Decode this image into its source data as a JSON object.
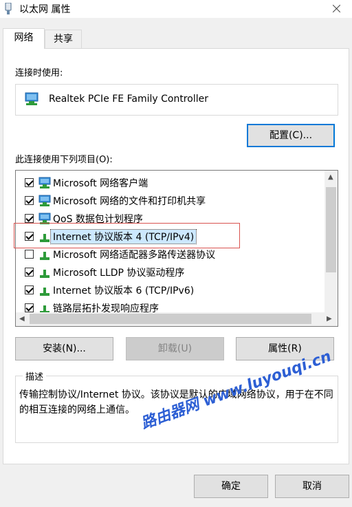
{
  "window": {
    "title": "以太网 属性"
  },
  "tabs": [
    {
      "label": "网络"
    },
    {
      "label": "共享"
    }
  ],
  "connect_using": {
    "label": "连接时使用:",
    "adapter": "Realtek PCIe FE Family Controller"
  },
  "configure_button": "配置(C)...",
  "items_label": "此连接使用下列项目(O):",
  "items": [
    {
      "label": "Microsoft 网络客户端",
      "checked": true,
      "icon": "network-client-icon"
    },
    {
      "label": "Microsoft 网络的文件和打印机共享",
      "checked": true,
      "icon": "network-client-icon"
    },
    {
      "label": "QoS 数据包计划程序",
      "checked": true,
      "icon": "network-client-icon"
    },
    {
      "label": "Internet 协议版本 4 (TCP/IPv4)",
      "checked": true,
      "selected": true,
      "icon": "protocol-icon"
    },
    {
      "label": "Microsoft 网络适配器多路传送器协议",
      "checked": false,
      "icon": "protocol-icon"
    },
    {
      "label": "Microsoft LLDP 协议驱动程序",
      "checked": true,
      "icon": "protocol-icon"
    },
    {
      "label": "Internet 协议版本 6 (TCP/IPv6)",
      "checked": true,
      "icon": "protocol-icon"
    },
    {
      "label": "链路层拓扑发现响应程序",
      "checked": true,
      "icon": "protocol-icon"
    }
  ],
  "buttons": {
    "install": "安装(N)...",
    "uninstall": "卸载(U)",
    "properties": "属性(R)",
    "ok": "确定",
    "cancel": "取消"
  },
  "description": {
    "legend": "描述",
    "text": "传输控制协议/Internet 协议。该协议是默认的广域网络协议，用于在不同的相互连接的网络上通信。"
  },
  "watermark": "路由器网 www.luyouqi.cn",
  "colors": {
    "accent": "#0078d7",
    "selection": "#cce8ff",
    "highlight_box": "#d9534f",
    "watermark": "#2d5fd4"
  }
}
